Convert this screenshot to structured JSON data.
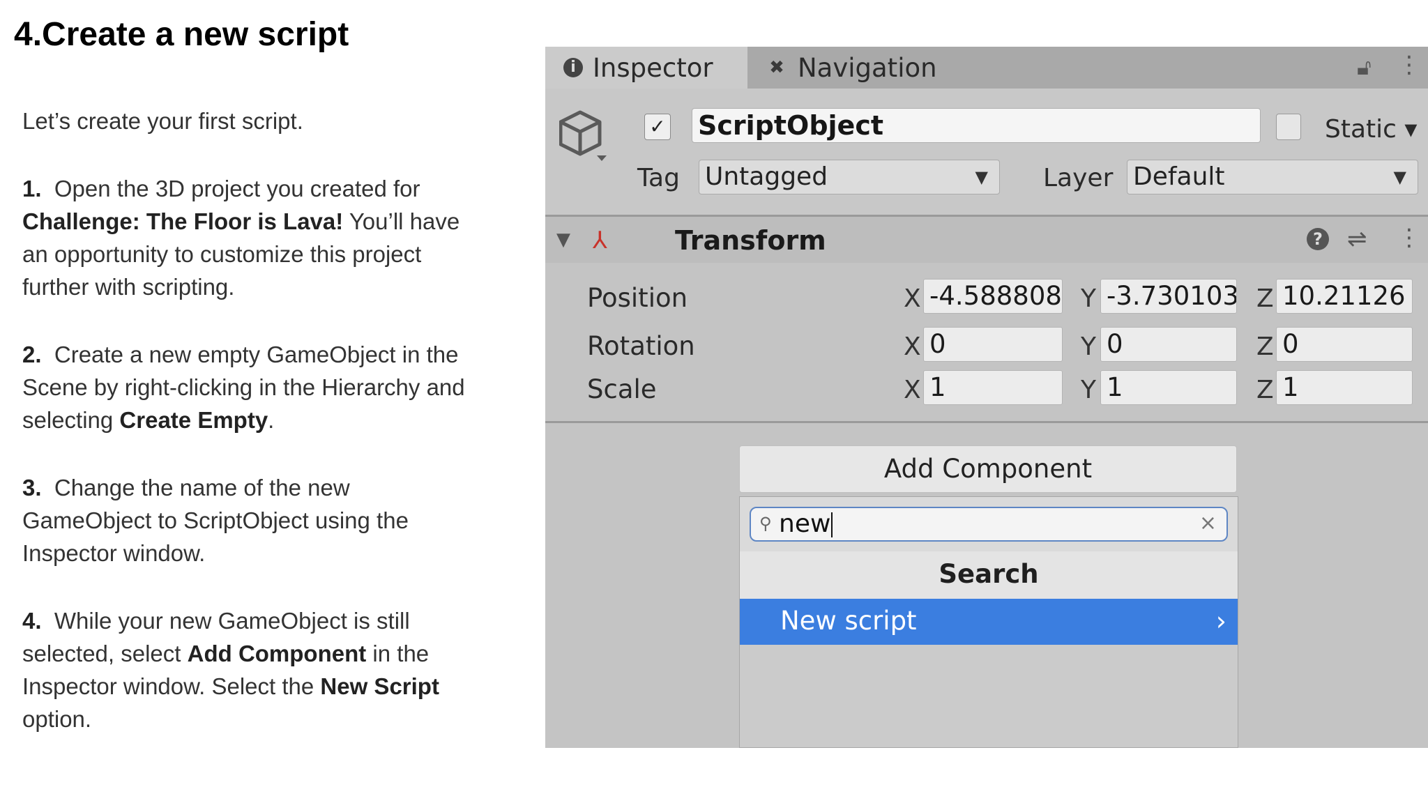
{
  "slide": {
    "title": "4.Create a new script",
    "intro": "Let’s create your first script.",
    "steps": [
      {
        "num": "1.",
        "parts": [
          {
            "t": "Open the 3D project you created for ",
            "b": false
          },
          {
            "t": "Challenge: The Floor is Lava!",
            "b": true
          },
          {
            "t": " You’ll have an opportunity to customize this project further with scripting.",
            "b": false
          }
        ]
      },
      {
        "num": "2.",
        "parts": [
          {
            "t": "Create a new empty GameObject in the Scene by right-clicking in the Hierarchy and selecting ",
            "b": false
          },
          {
            "t": "Create Empty",
            "b": true
          },
          {
            "t": ".",
            "b": false
          }
        ]
      },
      {
        "num": "3.",
        "parts": [
          {
            "t": "Change the name of the new GameObject to ScriptObject using the Inspector window.",
            "b": false
          }
        ]
      },
      {
        "num": "4.",
        "parts": [
          {
            "t": "While your new GameObject is still selected, select ",
            "b": false
          },
          {
            "t": "Add Component",
            "b": true
          },
          {
            "t": " in the Inspector window. Select the ",
            "b": false
          },
          {
            "t": "New Script",
            "b": true
          },
          {
            "t": " option.",
            "b": false
          }
        ]
      }
    ]
  },
  "inspector": {
    "tabs": [
      {
        "label": "Inspector",
        "icon": "info-icon"
      },
      {
        "label": "Navigation",
        "icon": "navigation-icon"
      }
    ],
    "object_name": "ScriptObject",
    "active_checked": true,
    "static_label": "Static",
    "static_checked": false,
    "tag_label": "Tag",
    "tag_value": "Untagged",
    "layer_label": "Layer",
    "layer_value": "Default",
    "transform": {
      "title": "Transform",
      "rows": [
        {
          "label": "Position",
          "x": "-4.588808",
          "y": "-3.730103",
          "z": "10.21126"
        },
        {
          "label": "Rotation",
          "x": "0",
          "y": "0",
          "z": "0"
        },
        {
          "label": "Scale",
          "x": "1",
          "y": "1",
          "z": "1"
        }
      ],
      "axis_x": "X",
      "axis_y": "Y",
      "axis_z": "Z"
    },
    "add_component_label": "Add Component",
    "search_value": "new",
    "popup_title": "Search",
    "popup_items": [
      "New script"
    ]
  },
  "colors": {
    "selection": "#3b7ee0",
    "panel": "#c4c4c4",
    "search_border": "#5e86c4"
  }
}
